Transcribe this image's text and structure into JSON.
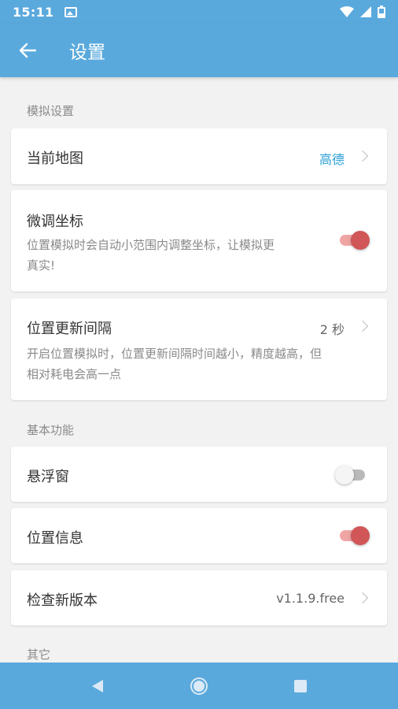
{
  "status_bar": {
    "time": "15:11"
  },
  "app_bar": {
    "title": "设置"
  },
  "sections": {
    "simulation": {
      "title": "模拟设置",
      "current_map": {
        "label": "当前地图",
        "value": "高德"
      },
      "fine_tune": {
        "label": "微调坐标",
        "desc_line1": "位置模拟时会自动小范围内调整坐标，让模拟更",
        "desc_line2": "真实!",
        "enabled": true
      },
      "update_interval": {
        "label": "位置更新间隔",
        "value": "2 秒",
        "desc_line1": "开启位置模拟时，位置更新间隔时间越小，精度越高，但",
        "desc_line2": "相对耗电会高一点"
      }
    },
    "basic": {
      "title": "基本功能",
      "floating_window": {
        "label": "悬浮窗",
        "enabled": false
      },
      "location_info": {
        "label": "位置信息",
        "enabled": true
      },
      "check_version": {
        "label": "检查新版本",
        "value": "v1.1.9.free"
      }
    },
    "other": {
      "title": "其它"
    }
  },
  "colors": {
    "primary": "#5aa9dd",
    "accent_link": "#2b9fd6",
    "toggle_on": "#d05658"
  }
}
